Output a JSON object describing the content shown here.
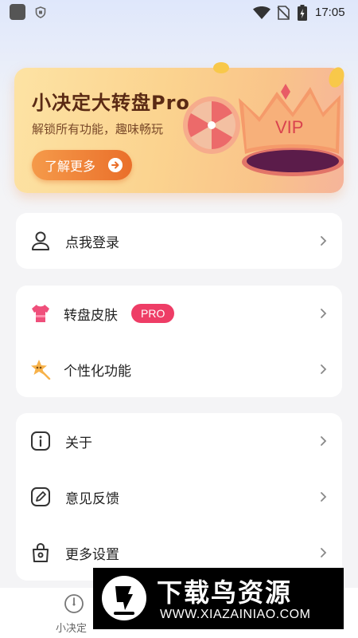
{
  "status_bar": {
    "time": "17:05",
    "icons": [
      "app-icon",
      "shield-icon",
      "wifi-icon",
      "no-signal-icon",
      "battery-charging-icon"
    ]
  },
  "vip_banner": {
    "title": "小决定大转盘Pro",
    "subtitle": "解锁所有功能，趣味畅玩",
    "button_label": "了解更多",
    "crown_text": "VIP"
  },
  "account_card": {
    "login_label": "点我登录",
    "login_icon": "user-icon"
  },
  "features_card": {
    "items": [
      {
        "label": "转盘皮肤",
        "icon": "tshirt-icon",
        "badge": "PRO"
      },
      {
        "label": "个性化功能",
        "icon": "star-wand-icon"
      }
    ]
  },
  "settings_card": {
    "items": [
      {
        "label": "关于",
        "icon": "info-icon"
      },
      {
        "label": "意见反馈",
        "icon": "edit-icon"
      },
      {
        "label": "更多设置",
        "icon": "settings-bag-icon"
      }
    ]
  },
  "tab_bar": {
    "tabs": [
      {
        "label": "小决定",
        "icon": "clock-dial-icon"
      }
    ]
  },
  "watermark": {
    "text": "下载鸟资源",
    "url": "WWW.XIAZAINIAO.COM"
  },
  "colors": {
    "accent": "#ee3d66",
    "vip_button": "#ea6f2a",
    "banner_title": "#5a2a14"
  }
}
